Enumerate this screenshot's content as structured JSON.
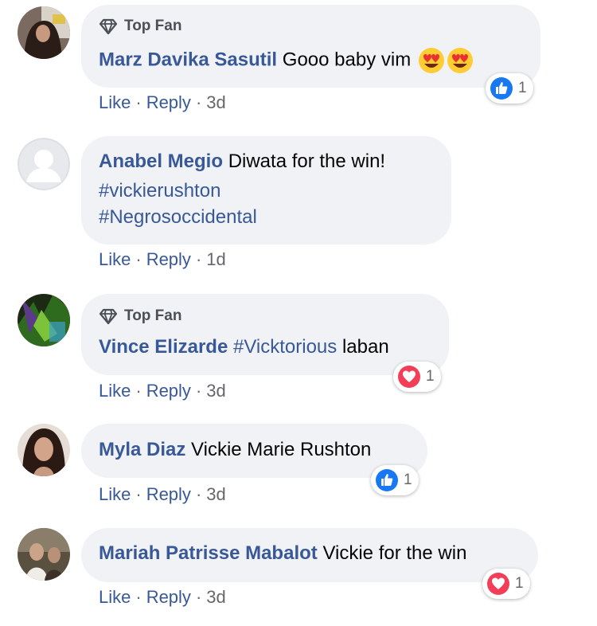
{
  "comments": [
    {
      "top_fan": "Top Fan",
      "author": "Marz Davika Sasutil",
      "text": "Gooo baby vim",
      "emojis": [
        "heart-eyes-emoji",
        "heart-eyes-emoji"
      ],
      "like": "Like",
      "reply": "Reply",
      "time": "3d",
      "reaction": {
        "type": "like",
        "count": "1"
      }
    },
    {
      "author": "Anabel Megio",
      "text": "Diwata for the win!",
      "hashtags": [
        "#vickierushton",
        "#Negrosoccidental"
      ],
      "like": "Like",
      "reply": "Reply",
      "time": "1d"
    },
    {
      "top_fan": "Top Fan",
      "author": "Vince Elizarde",
      "hashtag": "#Vicktorious",
      "text": "laban",
      "like": "Like",
      "reply": "Reply",
      "time": "3d",
      "reaction": {
        "type": "love",
        "count": "1"
      }
    },
    {
      "author": "Myla Diaz",
      "text": "Vickie Marie Rushton",
      "like": "Like",
      "reply": "Reply",
      "time": "3d",
      "reaction": {
        "type": "like",
        "count": "1"
      }
    },
    {
      "author": "Mariah Patrisse Mabalot",
      "text": "Vickie for the win",
      "like": "Like",
      "reply": "Reply",
      "time": "3d",
      "reaction": {
        "type": "love",
        "count": "1"
      }
    }
  ],
  "ui": {
    "separator": "·",
    "colors": {
      "author": "#385898",
      "bubble": "#f0f2f5",
      "meta": "#65676b",
      "like_blue": "#1877f2",
      "love_red": "#f33e58"
    }
  }
}
